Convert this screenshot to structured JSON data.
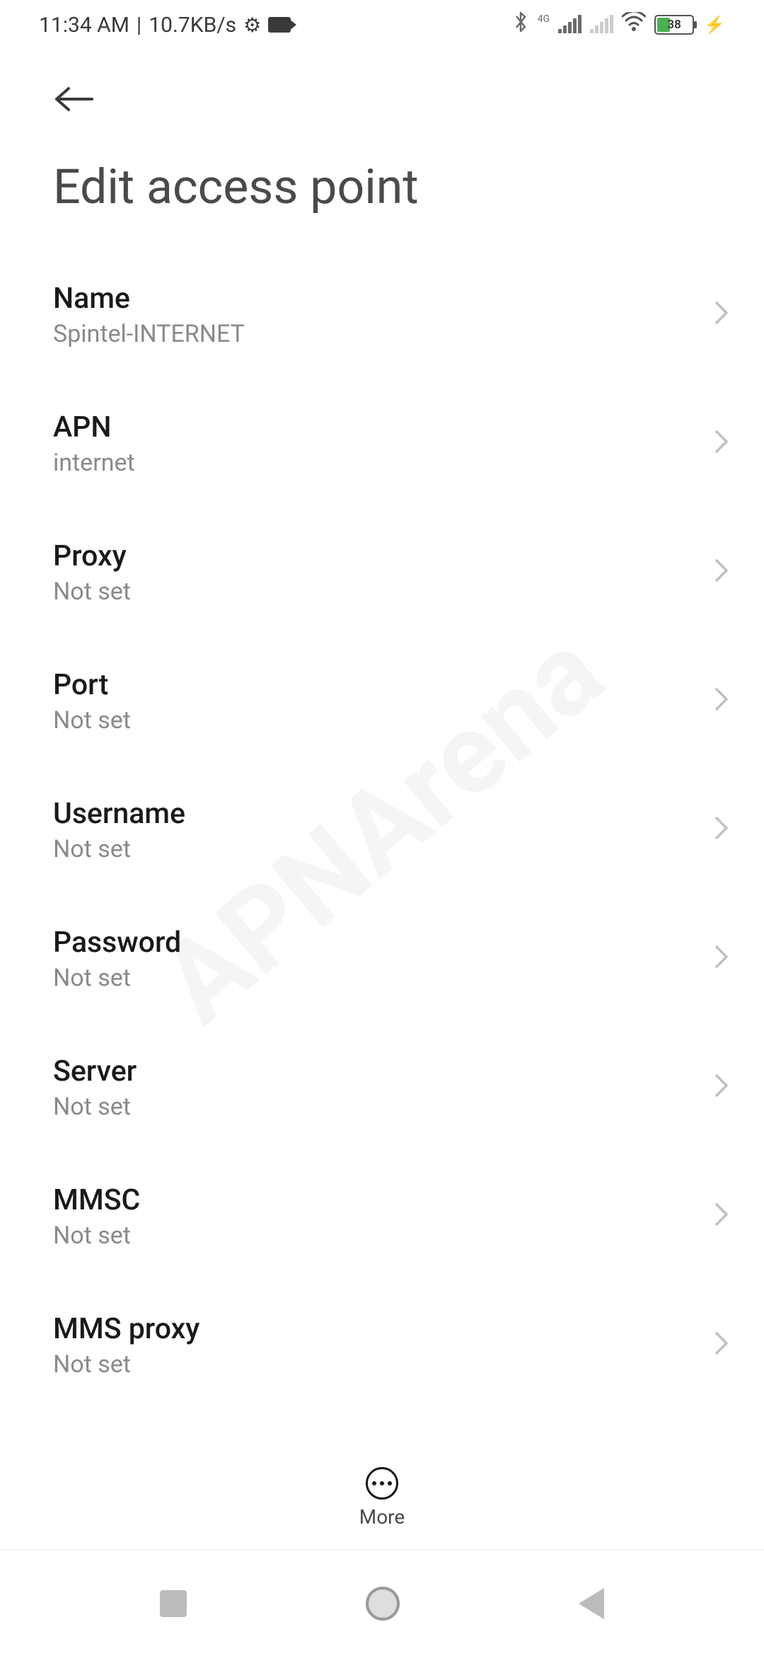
{
  "statusBar": {
    "time": "11:34 AM",
    "speed": "10.7KB/s",
    "battery": "38"
  },
  "page": {
    "title": "Edit access point"
  },
  "settings": [
    {
      "label": "Name",
      "value": "Spintel-INTERNET"
    },
    {
      "label": "APN",
      "value": "internet"
    },
    {
      "label": "Proxy",
      "value": "Not set"
    },
    {
      "label": "Port",
      "value": "Not set"
    },
    {
      "label": "Username",
      "value": "Not set"
    },
    {
      "label": "Password",
      "value": "Not set"
    },
    {
      "label": "Server",
      "value": "Not set"
    },
    {
      "label": "MMSC",
      "value": "Not set"
    },
    {
      "label": "MMS proxy",
      "value": "Not set"
    }
  ],
  "bottomBar": {
    "moreLabel": "More"
  },
  "watermark": "APNArena"
}
